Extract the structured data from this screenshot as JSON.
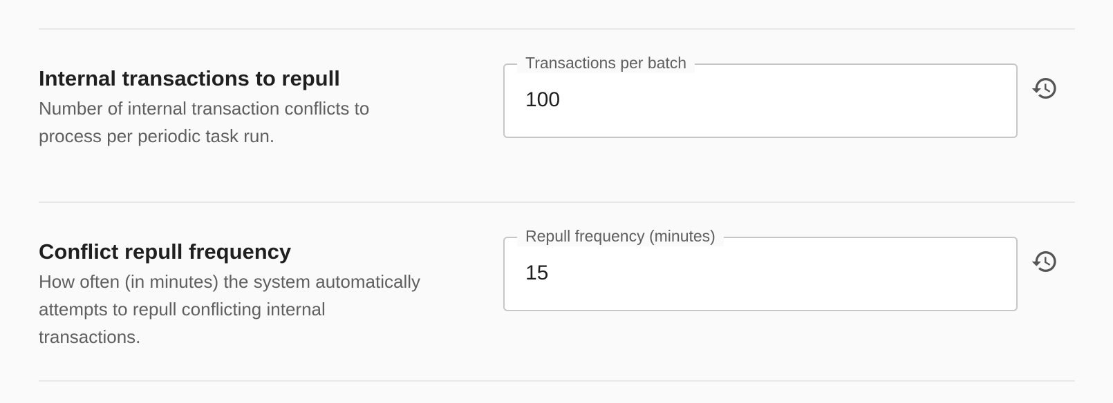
{
  "settings": [
    {
      "title": "Internal transactions to repull",
      "description": "Number of internal transaction conflicts to process per periodic task run.",
      "field_label": "Transactions per batch",
      "field_value": "100",
      "reset_icon": "history-icon"
    },
    {
      "title": "Conflict repull frequency",
      "description": "How often (in minutes) the system automatically attempts to repull conflicting internal transactions.",
      "field_label": "Repull frequency (minutes)",
      "field_value": "15",
      "reset_icon": "history-icon"
    }
  ]
}
